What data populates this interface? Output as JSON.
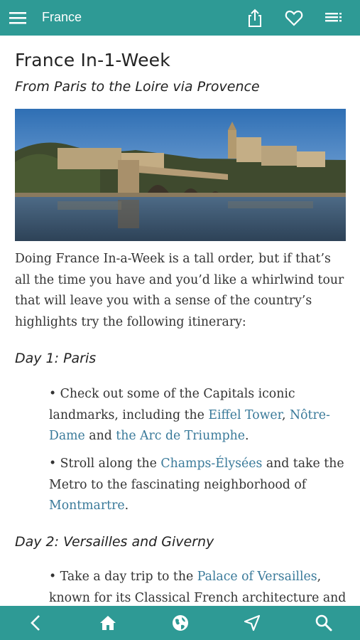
{
  "topbar": {
    "title": "France",
    "icons": [
      "menu-icon",
      "share-icon",
      "heart-icon",
      "list-icon"
    ]
  },
  "article": {
    "title": "France In-1-Week",
    "subtitle": "From Paris to the Loire via Provence",
    "intro": "Doing France In-a-Week is a tall order, but if that’s all the time you have and you’d like a whirlwind tour that will leave you with a sense of the country’s highlights try the following itinerary:",
    "day1": {
      "heading": "Day 1: Paris",
      "b1": {
        "t1": "• Check out some of the Capitals iconic landmarks, including the ",
        "l1": "Eiffel Tower",
        "t2": ", ",
        "l2": "Nôtre-Dame",
        "t3": " and ",
        "l3": "the Arc de Triumphe",
        "t4": "."
      },
      "b2": {
        "t1": "• Stroll along the ",
        "l1": "Champs-Élysées",
        "t2": " and take the Metro to the fascinating neighborhood of ",
        "l2": "Montmartre",
        "t3": "."
      }
    },
    "day2": {
      "heading": "Day 2: Versailles and Giverny",
      "b1": {
        "t1": "• Take a day trip to the ",
        "l1": "Palace of Versailles",
        "t2": ", known for its Classical French architecture and"
      }
    }
  },
  "bottombar": {
    "icons": [
      "back-icon",
      "home-icon",
      "globe-icon",
      "navigation-icon",
      "search-icon"
    ]
  },
  "colors": {
    "bar": "#2e9a95",
    "link": "#3a7a9a",
    "text": "#333333"
  }
}
